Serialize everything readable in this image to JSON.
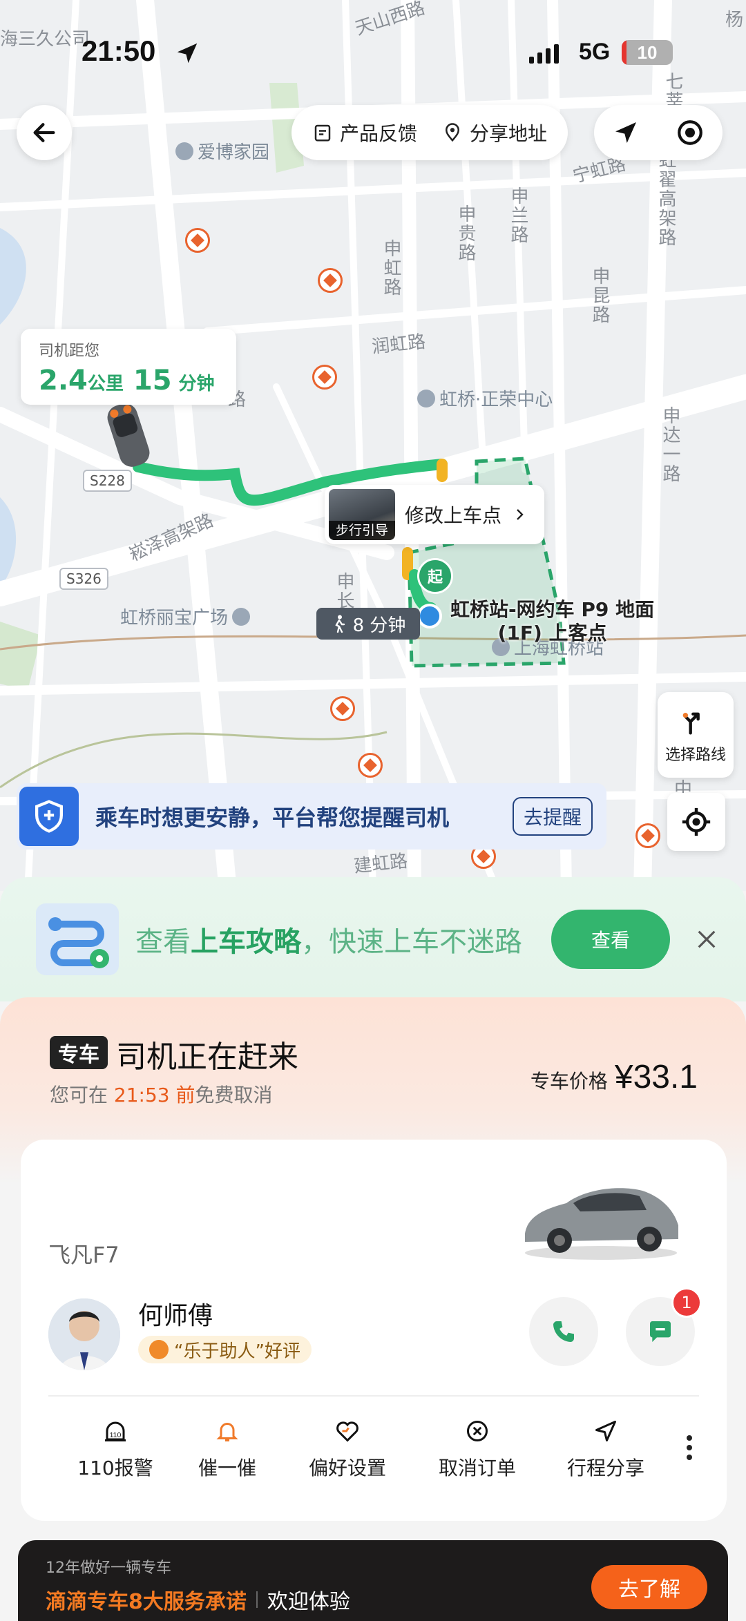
{
  "status_bar": {
    "time": "21:50",
    "network": "5G",
    "battery": "10",
    "battery_level": 0.1
  },
  "top_bar": {
    "feedback_label": "产品反馈",
    "share_label": "分享地址"
  },
  "map": {
    "labels": {
      "tianshan": "天山西路",
      "haisanjiu": "海三久公司",
      "qihua": "七莘路",
      "yang": "杨",
      "ningHong": "宁虹路",
      "hongQu": "虹翟高架路",
      "shenGui": "申贵路",
      "shenLan": "申兰路",
      "shenHong": "申虹路",
      "shenKun": "申昆路",
      "runHong": "润虹路",
      "shenDa": "申达一路",
      "songZe": "崧泽高架路",
      "shenChang": "申长",
      "jianHong": "建虹路",
      "lu": "路",
      "zhong": "中"
    },
    "pois": {
      "aibo": "爱博家园",
      "zhengrong": "虹桥·正荣中心",
      "libao": "虹桥丽宝广场",
      "hongqiao": "上海虹桥站"
    },
    "roads": {
      "s228": "S228",
      "s326": "S326"
    }
  },
  "driver_distance": {
    "label": "司机距您",
    "distance": "2.4",
    "distance_unit": "公里",
    "time": "15",
    "time_unit": "分钟"
  },
  "pickup": {
    "walk_guide_label": "步行引导",
    "modify_label": "修改上车点",
    "start_label": "起",
    "name_line1": "虹桥站-网约车 P9 地面",
    "name_line2": "(1F) 上客点",
    "walk_time": "8 分钟"
  },
  "route_button": {
    "label": "选择路线"
  },
  "safety": {
    "text": "乘车时想更安静，平台帮您提醒司机",
    "button": "去提醒"
  },
  "guide": {
    "prefix": "查看",
    "highlight": "上车攻略",
    "suffix": "，快速上车不迷路",
    "button": "查看"
  },
  "order": {
    "tag": "专车",
    "title": "司机正在赶来",
    "cancel_prefix": "您可在 ",
    "cancel_time": "21:53 前",
    "cancel_suffix": "免费取消",
    "price_label": "专车价格",
    "price_value": "¥33.1"
  },
  "driver": {
    "car_model": "飞凡F7",
    "name": "何师傅",
    "praise": "“乐于助人”好评",
    "message_count": "1"
  },
  "actions": [
    {
      "label": "110报警"
    },
    {
      "label": "催一催"
    },
    {
      "label": "偏好设置"
    },
    {
      "label": "取消订单"
    },
    {
      "label": "行程分享"
    }
  ],
  "promo": {
    "subtitle": "12年做好一辆专车",
    "highlight": "滴滴专车8大服务承诺",
    "text": "欢迎体验",
    "button": "去了解"
  },
  "colors": {
    "green": "#2aa56a",
    "orange": "#f5621a",
    "blue": "#2f6fe0"
  }
}
